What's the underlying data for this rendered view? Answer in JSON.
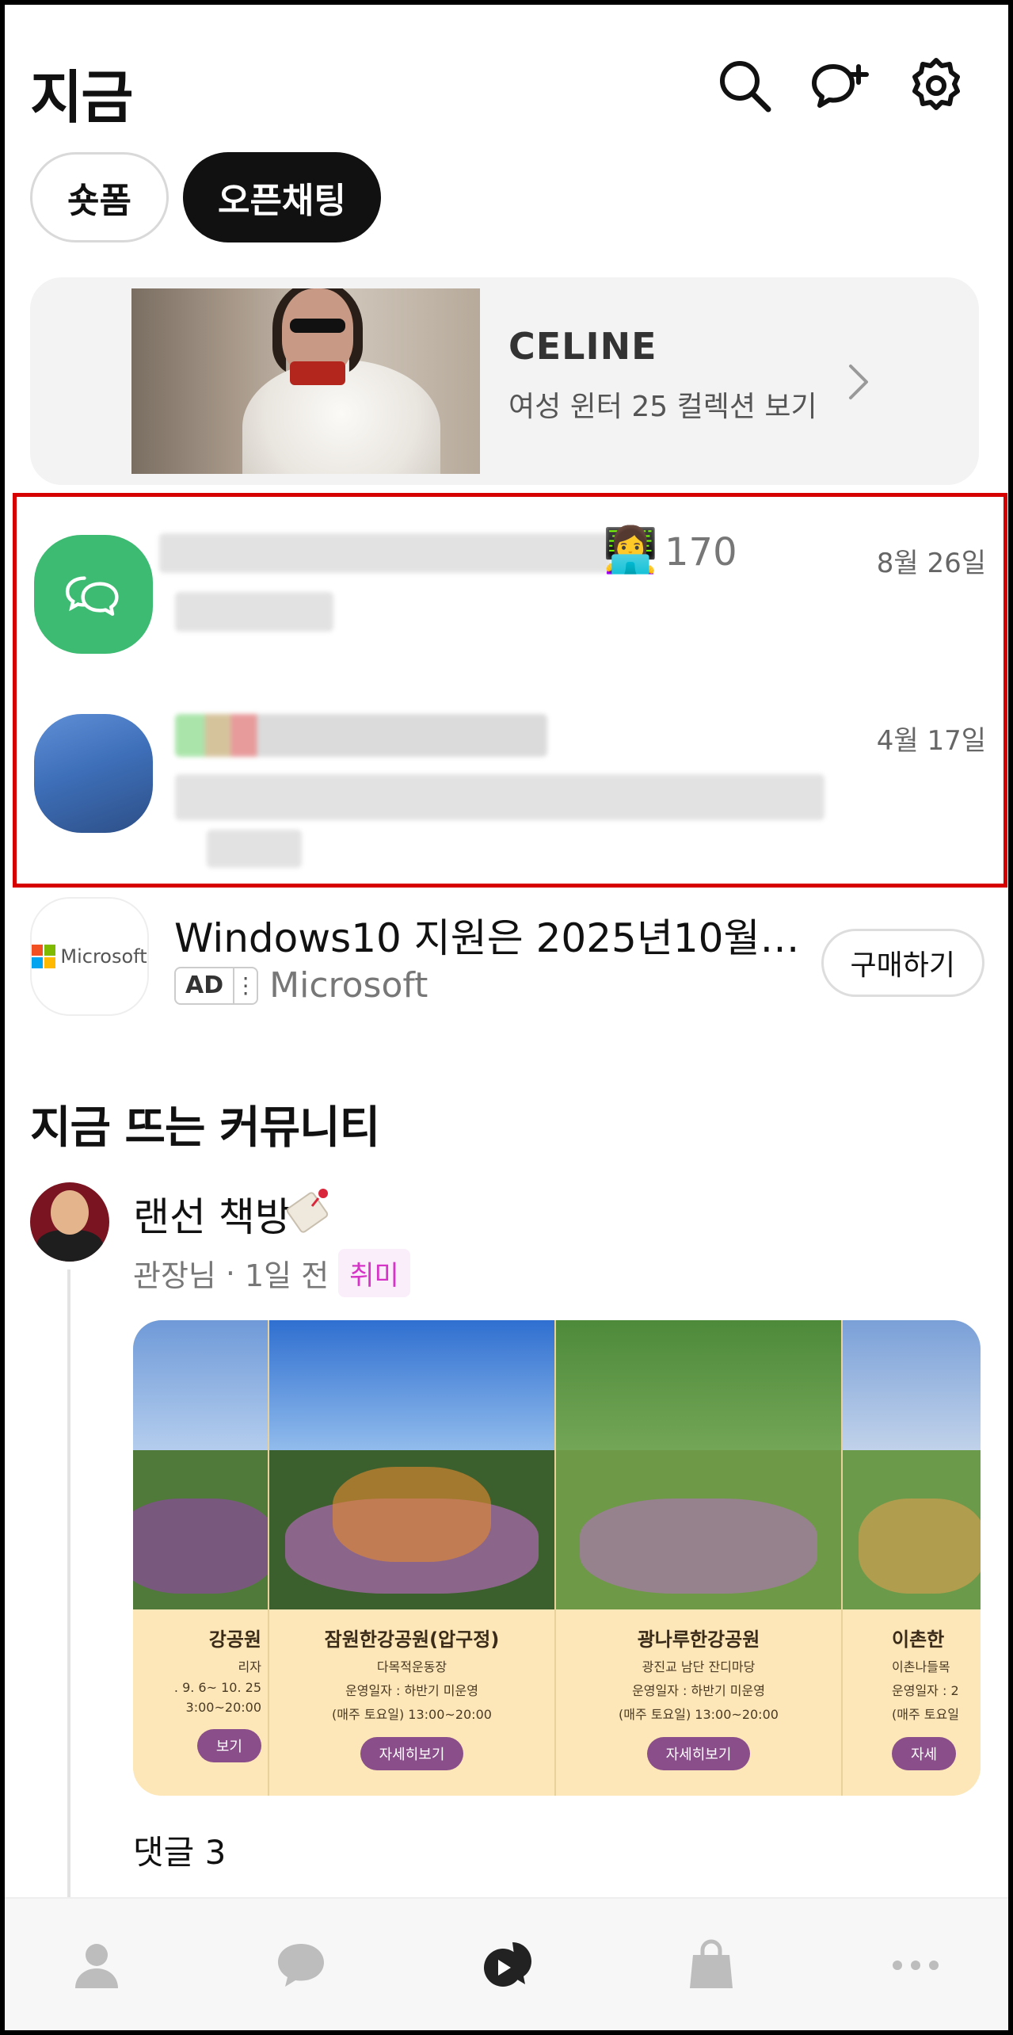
{
  "header": {
    "title": "지금"
  },
  "chips": [
    {
      "label": "숏폼",
      "active": false
    },
    {
      "label": "오픈채팅",
      "active": true
    }
  ],
  "banner": {
    "brand": "CELINE",
    "subtitle": "여성 윈터 25 컬렉션 보기"
  },
  "chats": [
    {
      "count": "170",
      "date": "8월 26일"
    },
    {
      "date": "4월 17일"
    }
  ],
  "ad": {
    "logo_text": "Microsoft",
    "title": "Windows10 지원은 2025년10월…",
    "badge": "AD",
    "source": "Microsoft",
    "button": "구매하기"
  },
  "community": {
    "section_title": "지금 뜨는 커뮤니티",
    "post": {
      "name": "랜선 책방",
      "author": "관장님",
      "time": "1일 전",
      "separator": "·",
      "category": "취미",
      "comments": "댓글 3"
    },
    "cards": [
      {
        "title": "강공원",
        "line1": "리자",
        "line2": ". 9. 6~ 10. 25",
        "line3": "3:00~20:00",
        "button": "보기"
      },
      {
        "title": "잠원한강공원(압구정)",
        "line1": "다목적운동장",
        "line2": "운영일자 : 하반기 미운영",
        "line3": "(매주 토요일) 13:00~20:00",
        "button": "자세히보기"
      },
      {
        "title": "광나루한강공원",
        "line1": "광진교 남단 잔디마당",
        "line2": "운영일자 : 하반기 미운영",
        "line3": "(매주 토요일) 13:00~20:00",
        "button": "자세히보기"
      },
      {
        "title": "이촌한",
        "line1": "이촌나들목",
        "line2": "운영일자 : 2",
        "line3": "(매주 토요일",
        "button": "자세"
      }
    ]
  },
  "colors": {
    "accent_green": "#3dbb72",
    "highlight_border": "#d60000",
    "category_text": "#d634c6"
  },
  "icons": {
    "header": [
      "search-icon",
      "add-chat-icon",
      "settings-icon"
    ],
    "nav": [
      "friends-icon",
      "chats-icon",
      "now-icon",
      "shopping-icon",
      "more-icon"
    ]
  }
}
